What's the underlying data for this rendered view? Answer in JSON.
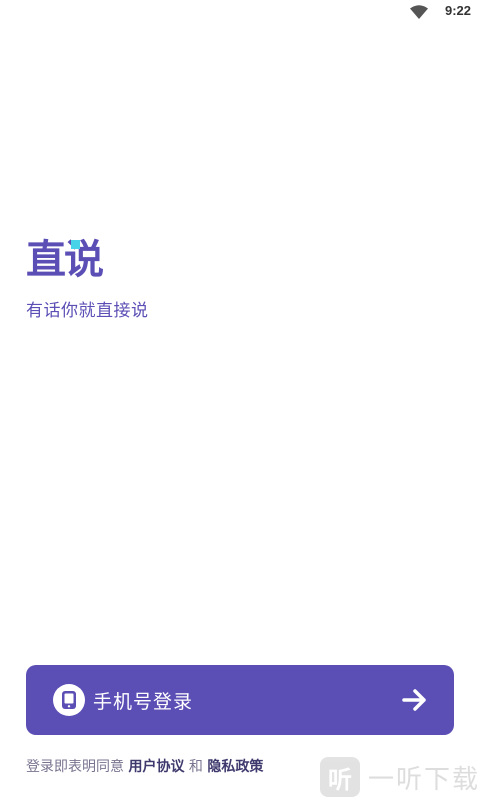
{
  "status_bar": {
    "time": "9:22"
  },
  "app": {
    "logo_text": "直说",
    "slogan": "有话你就直接说"
  },
  "login": {
    "button_label": "手机号登录"
  },
  "agreement": {
    "prefix": "登录即表明同意 ",
    "user_agreement": "用户协议",
    "and": " 和 ",
    "privacy_policy": "隐私政策"
  },
  "watermark": {
    "icon_glyph": "听",
    "text": "一听下载"
  },
  "colors": {
    "brand": "#5b4fb5",
    "accent": "#49d3e8",
    "background": "#ffffff"
  }
}
